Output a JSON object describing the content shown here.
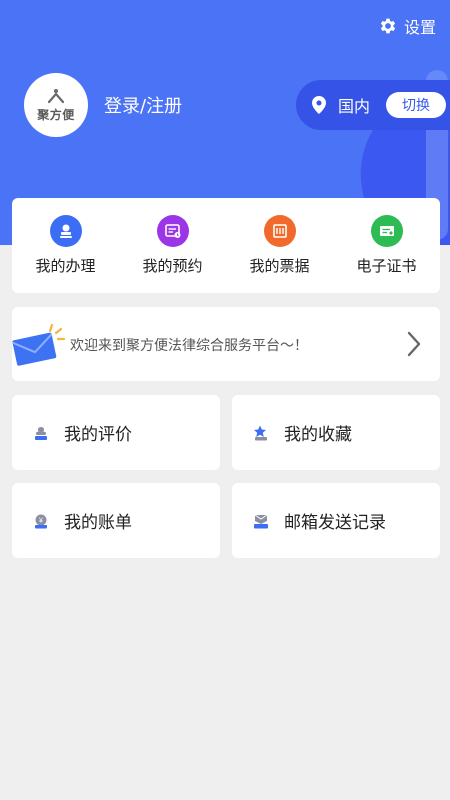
{
  "header": {
    "settings_label": "设置",
    "avatar_text": "聚方便",
    "login_label": "登录/注册",
    "location_label": "国内",
    "switch_label": "切换",
    "bg_color": "#4b73f5"
  },
  "quick_actions": [
    {
      "label": "我的办理",
      "icon": "stamp-icon",
      "color": "#3b6ef5"
    },
    {
      "label": "我的预约",
      "icon": "calendar-icon",
      "color": "#9b36e8"
    },
    {
      "label": "我的票据",
      "icon": "receipt-icon",
      "color": "#f26a2b"
    },
    {
      "label": "电子证书",
      "icon": "certificate-icon",
      "color": "#2dbb53"
    }
  ],
  "welcome": {
    "text": "欢迎来到聚方便法律综合服务平台～！"
  },
  "cards": [
    {
      "label": "我的评价",
      "icon": "review-icon"
    },
    {
      "label": "我的收藏",
      "icon": "star-icon"
    },
    {
      "label": "我的账单",
      "icon": "money-bag-icon"
    },
    {
      "label": "邮箱发送记录",
      "icon": "mail-tray-icon"
    }
  ]
}
